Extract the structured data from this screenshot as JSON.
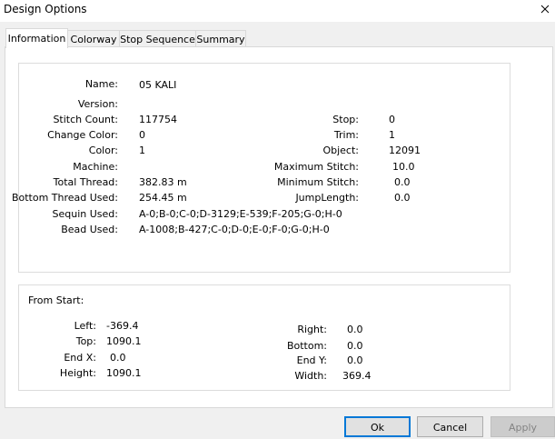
{
  "window": {
    "title": "Design Options"
  },
  "tabs": [
    {
      "label": "Information"
    },
    {
      "label": "Colorway"
    },
    {
      "label": "Stop Sequence"
    },
    {
      "label": "Summary"
    }
  ],
  "info": {
    "name": {
      "label": "Name:",
      "value": "05 KALI"
    },
    "version": {
      "label": "Version:",
      "value": ""
    },
    "stitch_count": {
      "label": "Stitch Count:",
      "value": "117754"
    },
    "change_color": {
      "label": "Change Color:",
      "value": "0"
    },
    "color": {
      "label": "Color:",
      "value": "1"
    },
    "machine": {
      "label": "Machine:",
      "value": ""
    },
    "total_thread": {
      "label": "Total Thread:",
      "value": "382.83 m"
    },
    "bottom_thread": {
      "label": "Bottom Thread Used:",
      "value": "254.45 m"
    },
    "sequin_used": {
      "label": "Sequin Used:",
      "value": "A-0;B-0;C-0;D-3129;E-539;F-205;G-0;H-0"
    },
    "bead_used": {
      "label": "Bead Used:",
      "value": "A-1008;B-427;C-0;D-0;E-0;F-0;G-0;H-0"
    },
    "stop": {
      "label": "Stop:",
      "value": "0"
    },
    "trim": {
      "label": "Trim:",
      "value": "1"
    },
    "object": {
      "label": "Object:",
      "value": "12091"
    },
    "max_stitch": {
      "label": "Maximum Stitch:",
      "value": "10.0"
    },
    "min_stitch": {
      "label": "Minimum Stitch:",
      "value": "0.0"
    },
    "jump_length": {
      "label": "JumpLength:",
      "value": "0.0"
    }
  },
  "from_start": {
    "heading": "From Start:",
    "left": {
      "label": "Left:",
      "value": "-369.4"
    },
    "top": {
      "label": "Top:",
      "value": "1090.1"
    },
    "end_x": {
      "label": "End X:",
      "value": "0.0"
    },
    "height": {
      "label": "Height:",
      "value": "1090.1"
    },
    "right": {
      "label": "Right:",
      "value": "0.0"
    },
    "bottom": {
      "label": "Bottom:",
      "value": "0.0"
    },
    "end_y": {
      "label": "End Y:",
      "value": "0.0"
    },
    "width": {
      "label": "Width:",
      "value": "369.4"
    }
  },
  "buttons": {
    "ok": "Ok",
    "cancel": "Cancel",
    "apply": "Apply"
  }
}
